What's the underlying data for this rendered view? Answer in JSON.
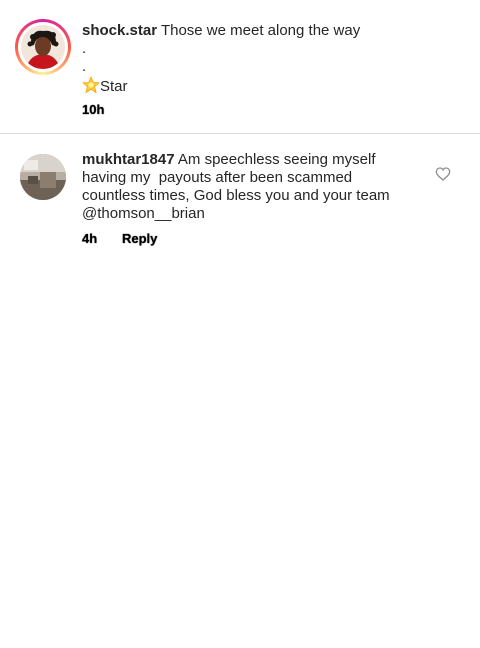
{
  "caption": {
    "username": "shock.star",
    "text": "Those we meet along the way",
    "dot1": ".",
    "dot2": ".",
    "star_line": "Star",
    "time": "10h"
  },
  "comment": {
    "username": "mukhtar1847",
    "line1": "Am speechless seeing myself",
    "line2": "having my  payouts after been scammed",
    "line3": "countless times, God bless you and your team",
    "line4": "@thomson__brian",
    "time": "4h",
    "reply_label": "Reply"
  },
  "icons": {
    "star": "glowing-star-emoji",
    "like": "heart-outline-icon"
  },
  "colors": {
    "story_ring": [
      "#d6249f",
      "#fd5949",
      "#fdf497"
    ],
    "divider": "#dbdbdb",
    "text": "#262626"
  }
}
